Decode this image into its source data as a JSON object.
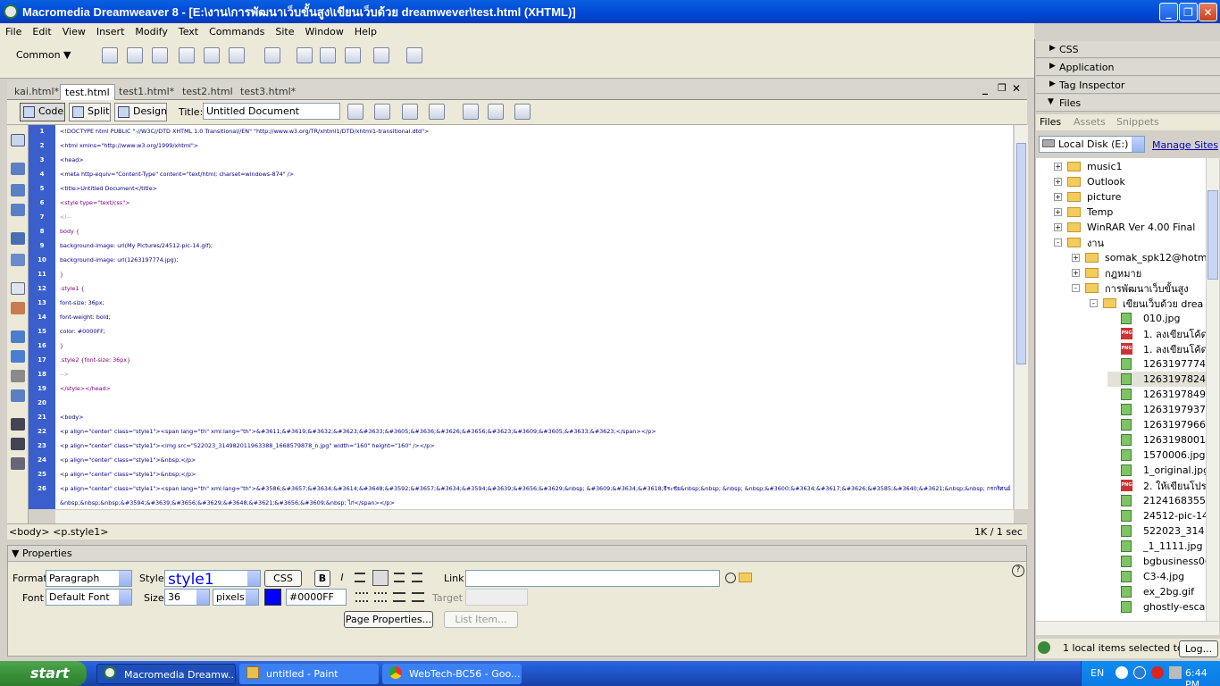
{
  "window": {
    "title": "Macromedia Dreamweaver 8 - [E:\\งาน\\การพัฒนาเว็บขั้นสูง\\เขียนเว็บด้วย  dreamwever\\test.html (XHTML)]"
  },
  "menu": [
    "File",
    "Edit",
    "View",
    "Insert",
    "Modify",
    "Text",
    "Commands",
    "Site",
    "Window",
    "Help"
  ],
  "insertbar": {
    "category": "Common"
  },
  "doctabs": [
    "kai.html*",
    "test.html",
    "test1.html*",
    "test2.html",
    "test3.html*"
  ],
  "doctoolbar": {
    "code": "Code",
    "split": "Split",
    "design": "Design",
    "title_label": "Title:",
    "title_value": "Untitled Document"
  },
  "code_lines": [
    "<!DOCTYPE html PUBLIC \"-//W3C//DTD XHTML 1.0 Transitional//EN\" \"http://www.w3.org/TR/xhtml1/DTD/xhtml1-transitional.dtd\">",
    "<html xmlns=\"http://www.w3.org/1999/xhtml\">",
    "<head>",
    "<meta http-equiv=\"Content-Type\" content=\"text/html; charset=windows-874\" />",
    "<title>Untitled Document</title>",
    "<style type=\"text/css\">",
    "<!--",
    "body {",
    "    background-image: url(My Pictures/24512-pic-14.gif);",
    "    background-image: url(1263197774.jpg);",
    "}",
    ".style1 {",
    "    font-size: 36px;",
    "    font-weight: bold;",
    "    color: #0000FF;",
    "}",
    ".style2 {font-size: 36px}",
    "-->",
    "</style></head>",
    "",
    "<body>",
    "<p align=\"center\" class=\"style1\"><span lang=\"th\" xml:lang=\"th\">&#3611;&#3619;&#3632;&#3623;&#3633;&#3605;&#3636;&#3626;&#3656;&#3623;&#3609;&#3605;&#3633;&#3623;</span></p>",
    "<p align=\"center\" class=\"style1\"><img src=\"522023_314982011963388_1668579878_n.jpg\" width=\"160\" height=\"160\" /></p>",
    "<p align=\"center\" class=\"style1\">&nbsp;</p>",
    "<p align=\"center\" class=\"style1\">&nbsp;</p>",
    "<p align=\"center\" class=\"style1\"><span lang=\"th\" xml:lang=\"th\">&#3586;&#3657;&#3634;&#3614;&#3648;&#3592;&#3657;&#3634;&#3594;&#3639;&#3656;&#3629;&nbsp; &#3609;&#3634;&#3618;ธีระชัย&nbsp;&nbsp; &nbsp; &nbsp;&#3600;&#3634;&#3617;&#3626;&#3585;&#3640;&#3621;&nbsp;&nbsp; กรกริศนย์",
    "&nbsp;&nbsp;&nbsp;&#3594;&#3639;&#3656;&#3629;&#3648;&#3621;&#3656;&#3609;&nbsp; ไก่</span></p>"
  ],
  "line_numbers": [
    "1",
    "2",
    "3",
    "4",
    "5",
    "6",
    "7",
    "8",
    "9",
    "10",
    "11",
    "12",
    "13",
    "14",
    "15",
    "16",
    "17",
    "18",
    "19",
    "20",
    "21",
    "22",
    "23",
    "24",
    "25",
    "26",
    ""
  ],
  "status": {
    "tags": "<body> <p.style1>",
    "size": "1K / 1 sec"
  },
  "properties": {
    "header": "Properties",
    "format_label": "Format",
    "format_value": "Paragraph",
    "style_label": "Style",
    "style_value": "style1",
    "css_button": "CSS",
    "bold": "B",
    "italic": "I",
    "link_label": "Link",
    "link_value": "",
    "font_label": "Font",
    "font_value": "Default Font",
    "size_label": "Size",
    "size_value": "36",
    "size_unit": "pixels",
    "color_value": "#0000FF",
    "target_label": "Target",
    "page_properties": "Page Properties...",
    "list_item": "List Item..."
  },
  "right_panel": {
    "css": "CSS",
    "application": "Application",
    "tag_inspector": "Tag Inspector",
    "files": "Files",
    "tabs": [
      "Files",
      "Assets",
      "Snippets"
    ],
    "site_select": "Local Disk (E:)",
    "manage_sites": "Manage Sites",
    "status": "1 local items selected tota",
    "log_button": "Log..."
  },
  "tree": [
    {
      "label": "music1",
      "kind": "folder",
      "depth": 0,
      "pm": "+"
    },
    {
      "label": "Outlook",
      "kind": "folder",
      "depth": 0,
      "pm": "+"
    },
    {
      "label": "picture",
      "kind": "folder",
      "depth": 0,
      "pm": "+"
    },
    {
      "label": "Temp",
      "kind": "folder",
      "depth": 0,
      "pm": "+"
    },
    {
      "label": "WinRAR Ver 4.00 Final",
      "kind": "folder",
      "depth": 0,
      "pm": "+"
    },
    {
      "label": "งาน",
      "kind": "folder",
      "depth": 0,
      "pm": "-"
    },
    {
      "label": "somak_spk12@hotma",
      "kind": "folder",
      "depth": 1,
      "pm": "+"
    },
    {
      "label": "กฎหมาย",
      "kind": "folder",
      "depth": 1,
      "pm": "+"
    },
    {
      "label": "การพัฒนาเว็บขั้นสูง",
      "kind": "folder",
      "depth": 1,
      "pm": "-"
    },
    {
      "label": "เขียนเว็บด้วย  drea",
      "kind": "folder",
      "depth": 2,
      "pm": "-"
    },
    {
      "label": "010.jpg",
      "kind": "img",
      "depth": 3
    },
    {
      "label": "1. ลงเขียนโค้ด",
      "kind": "png",
      "depth": 3
    },
    {
      "label": "1. ลงเขียนโค้ด",
      "kind": "png",
      "depth": 3
    },
    {
      "label": "1263197774",
      "kind": "img",
      "depth": 3
    },
    {
      "label": "1263197824",
      "kind": "img",
      "depth": 3
    },
    {
      "label": "1263197849",
      "kind": "img",
      "depth": 3
    },
    {
      "label": "1263197937",
      "kind": "img",
      "depth": 3
    },
    {
      "label": "1263197966",
      "kind": "img",
      "depth": 3
    },
    {
      "label": "1263198001",
      "kind": "img",
      "depth": 3
    },
    {
      "label": "1570006.jpg",
      "kind": "img",
      "depth": 3
    },
    {
      "label": "1_original.jpg",
      "kind": "img",
      "depth": 3
    },
    {
      "label": "2. ให้เขียนโปร",
      "kind": "png",
      "depth": 3
    },
    {
      "label": "2124168355_",
      "kind": "img",
      "depth": 3
    },
    {
      "label": "24512-pic-14",
      "kind": "img",
      "depth": 3
    },
    {
      "label": "522023_314",
      "kind": "img",
      "depth": 3
    },
    {
      "label": "_1_1111.jpg",
      "kind": "img",
      "depth": 3
    },
    {
      "label": "bgbusiness06",
      "kind": "img",
      "depth": 3
    },
    {
      "label": "C3-4.jpg",
      "kind": "img",
      "depth": 3
    },
    {
      "label": "ex_2bg.gif",
      "kind": "img",
      "depth": 3
    },
    {
      "label": "ghostly-esca",
      "kind": "img",
      "depth": 3
    }
  ],
  "taskbar": {
    "start": "start",
    "tasks": [
      "Macromedia Dreamw...",
      "untitled - Paint",
      "WebTech-BC56 - Goo..."
    ],
    "lang": "EN",
    "clock": "6:44 PM"
  },
  "colors": {
    "accent": "#0046d5",
    "line_gutter": "#3a5fcd",
    "swatch": "#0000FF",
    "taskbar": "#245edb",
    "start": "#3c963c"
  }
}
